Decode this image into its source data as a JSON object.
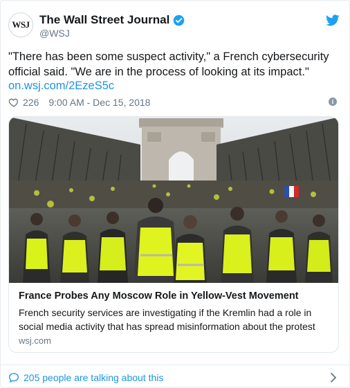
{
  "account": {
    "avatar_text": "WSJ",
    "name": "The Wall Street Journal",
    "handle": "@WSJ",
    "verified": true
  },
  "tweet": {
    "text": "\"There has been some suspect activity,\" a French cybersecurity official said. \"We are in the process of looking at its impact.\"",
    "link": "on.wsj.com/2EzeS5c",
    "likes": "226",
    "timestamp": "9:00 AM - Dec 15, 2018"
  },
  "card": {
    "image_alt": "Yellow-vest protesters on the Champs-Élysées with the Arc de Triomphe behind",
    "title": "France Probes Any Moscow Role in Yellow-Vest Movement",
    "description": "French security services are investigating if the Kremlin had a role in social media activity that has spread misinformation about the protest",
    "domain": "wsj.com"
  },
  "footer": {
    "talking": "205 people are talking about this"
  },
  "colors": {
    "link": "#1b95e0",
    "muted": "#657786",
    "text": "#14171a",
    "vest": "#d9f21a"
  },
  "icons": [
    "verified-badge-icon",
    "twitter-bird-icon",
    "heart-icon",
    "info-icon",
    "speech-bubble-icon",
    "chevron-right-icon"
  ]
}
